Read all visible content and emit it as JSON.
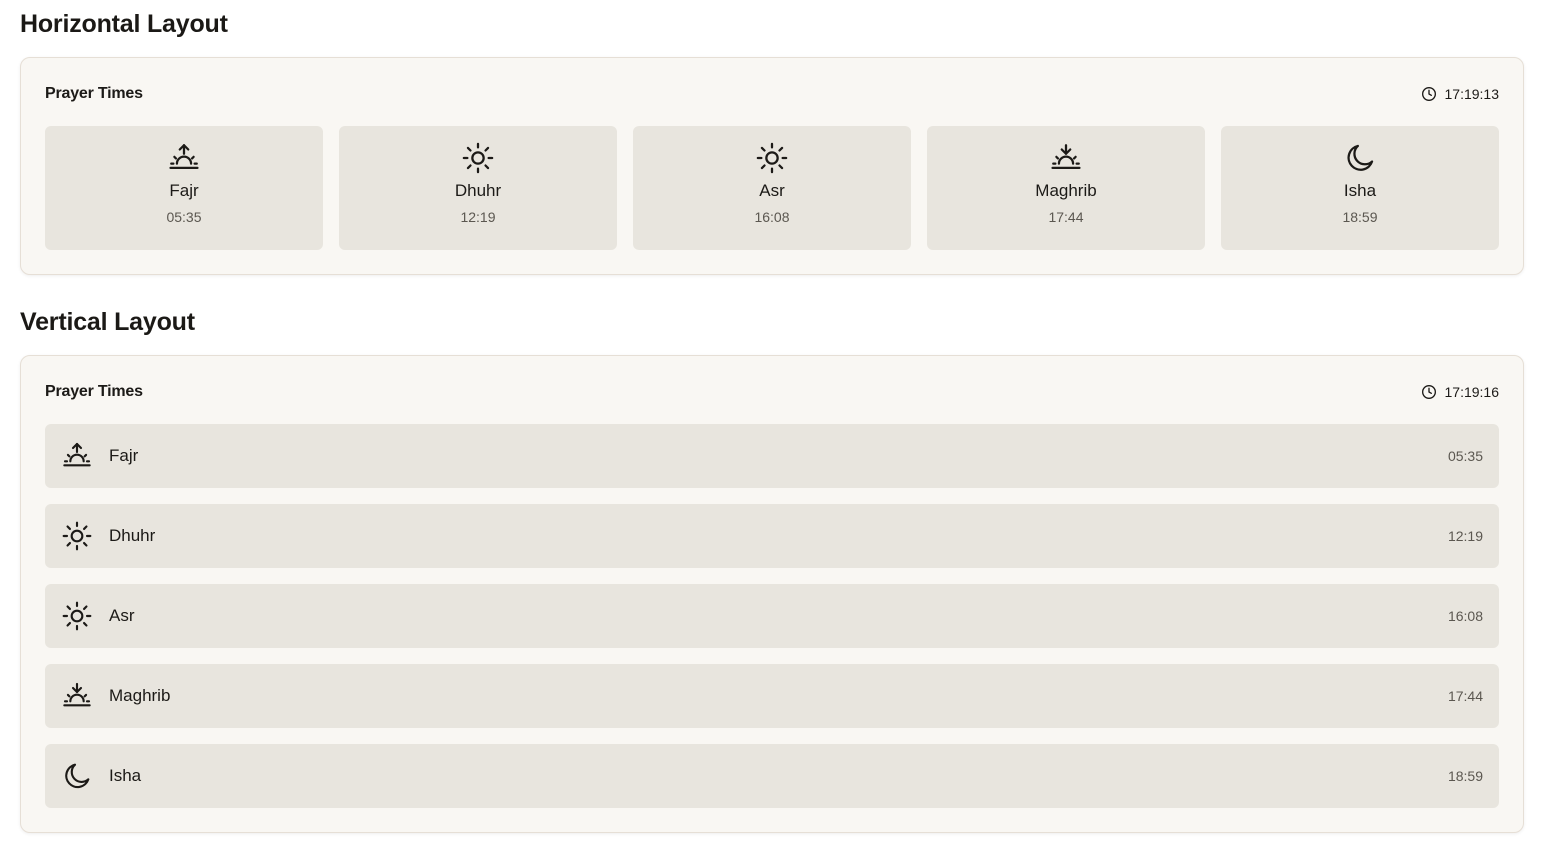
{
  "horizontal": {
    "section_title": "Horizontal Layout",
    "card_title": "Prayer Times",
    "clock_icon": "clock-icon",
    "current_time": "17:19:13",
    "prayers": [
      {
        "name": "Fajr",
        "time": "05:35",
        "icon": "sunrise-icon"
      },
      {
        "name": "Dhuhr",
        "time": "12:19",
        "icon": "sun-icon"
      },
      {
        "name": "Asr",
        "time": "16:08",
        "icon": "sun-icon"
      },
      {
        "name": "Maghrib",
        "time": "17:44",
        "icon": "sunset-icon"
      },
      {
        "name": "Isha",
        "time": "18:59",
        "icon": "moon-icon"
      }
    ]
  },
  "vertical": {
    "section_title": "Vertical Layout",
    "card_title": "Prayer Times",
    "clock_icon": "clock-icon",
    "current_time": "17:19:16",
    "prayers": [
      {
        "name": "Fajr",
        "time": "05:35",
        "icon": "sunrise-icon"
      },
      {
        "name": "Dhuhr",
        "time": "12:19",
        "icon": "sun-icon"
      },
      {
        "name": "Asr",
        "time": "16:08",
        "icon": "sun-icon"
      },
      {
        "name": "Maghrib",
        "time": "17:44",
        "icon": "sunset-icon"
      },
      {
        "name": "Isha",
        "time": "18:59",
        "icon": "moon-icon"
      }
    ]
  },
  "colors": {
    "page_background": "#ffffff",
    "card_background": "#f9f7f3",
    "card_border": "#e6dfd6",
    "tile_background": "#e8e5de",
    "text_primary": "#1c1a17",
    "text_secondary": "#5b5750"
  }
}
